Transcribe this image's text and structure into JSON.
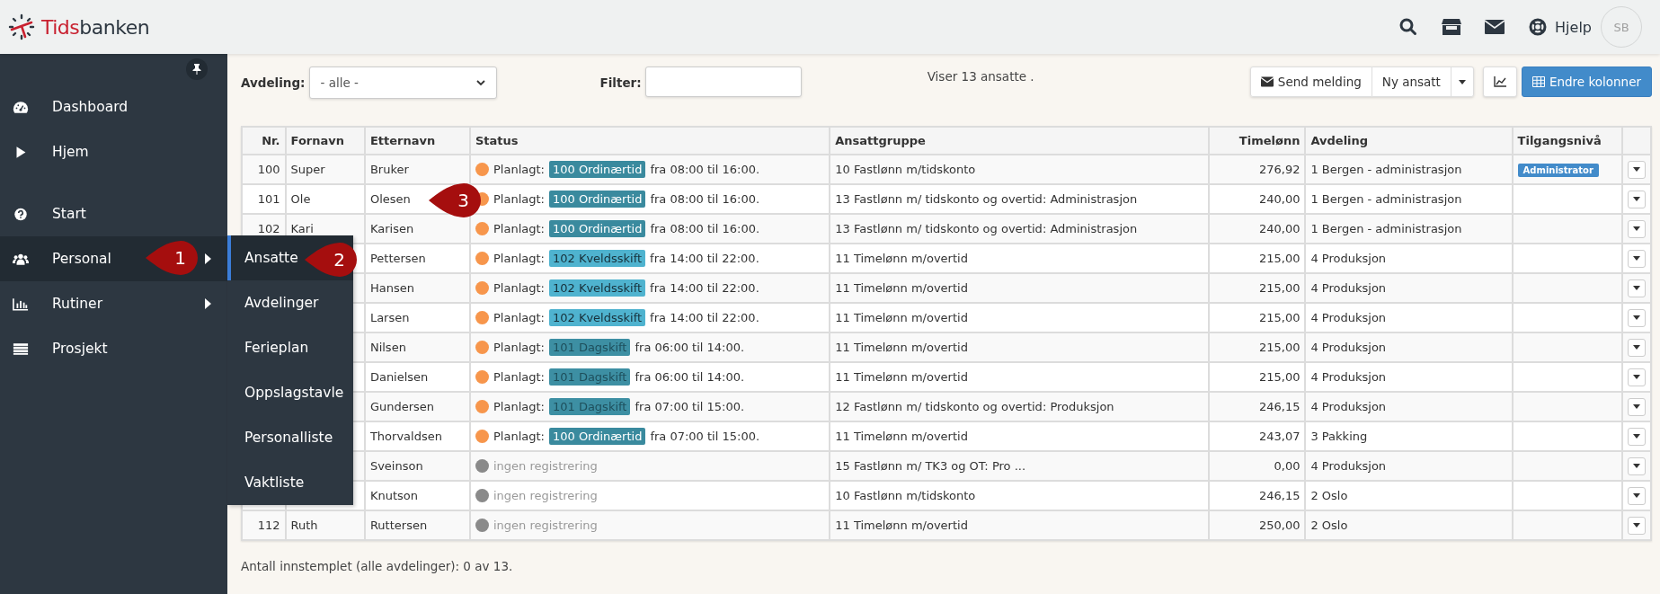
{
  "header": {
    "logo_accent": "Tids",
    "logo_rest": "banken",
    "help": "Hjelp",
    "avatar": "SB"
  },
  "sidebar": {
    "groups": [
      [
        {
          "label": "Dashboard",
          "selected": false,
          "has_submenu": false
        },
        {
          "label": "Hjem",
          "selected": false,
          "has_submenu": false
        }
      ],
      [
        {
          "label": "Start",
          "selected": false,
          "has_submenu": false
        },
        {
          "label": "Personal",
          "selected": true,
          "has_submenu": true
        },
        {
          "label": "Rutiner",
          "selected": false,
          "has_submenu": true
        },
        {
          "label": "Prosjekt",
          "selected": false,
          "has_submenu": false
        }
      ]
    ]
  },
  "submenu": {
    "items": [
      {
        "label": "Ansatte",
        "selected": true
      },
      {
        "label": "Avdelinger",
        "selected": false
      },
      {
        "label": "Ferieplan",
        "selected": false
      },
      {
        "label": "Oppslagstavle",
        "selected": false
      },
      {
        "label": "Personalliste",
        "selected": false
      },
      {
        "label": "Vaktliste",
        "selected": false
      }
    ]
  },
  "toolbar": {
    "department_label": "Avdeling:",
    "department_value": "- alle -",
    "filter_label": "Filter:",
    "summary": "Viser 13 ansatte .",
    "buttons": [
      "Send melding",
      "Ny ansatt"
    ],
    "columns_button": "Endre kolonner"
  },
  "table": {
    "columns": [
      "Nr.",
      "Fornavn",
      "Etternavn",
      "Status",
      "Ansattgruppe",
      "Timelønn",
      "Avdeling",
      "Tilgangsnivå"
    ],
    "rows": [
      {
        "nr": "100",
        "first": "Super",
        "last": "Bruker",
        "status": {
          "kind": "planned",
          "label": "Planlagt:",
          "shift": "100 Ordinærtid",
          "color": "#3a8a9e",
          "time": "fra 08:00 til 16:00."
        },
        "group": "10 Fastlønn m/tidskonto",
        "wage": "276,92",
        "department": "1 Bergen - administrasjon",
        "access": "Administrator"
      },
      {
        "nr": "101",
        "first": "Ole",
        "last": "Olesen",
        "status": {
          "kind": "planned",
          "label": "Planlagt:",
          "shift": "100 Ordinærtid",
          "color": "#3a8a9e",
          "time": "fra 08:00 til 16:00."
        },
        "group": "13 Fastlønn m/ tidskonto og overtid: Administrasjon",
        "wage": "240,00",
        "department": "1 Bergen - administrasjon"
      },
      {
        "nr": "102",
        "first": "Kari",
        "last": "Karisen",
        "status": {
          "kind": "planned",
          "label": "Planlagt:",
          "shift": "100 Ordinærtid",
          "color": "#3a8a9e",
          "time": "fra 08:00 til 16:00."
        },
        "group": "13 Fastlønn m/ tidskonto og overtid: Administrasjon",
        "wage": "240,00",
        "department": "1 Bergen - administrasjon"
      },
      {
        "last": "Pettersen",
        "status": {
          "kind": "planned",
          "label": "Planlagt:",
          "shift": "102 Kveldsskift",
          "color": "#4fb3cf",
          "time": "fra 14:00 til 22:00."
        },
        "group": "11 Timelønn m/overtid",
        "wage": "215,00",
        "department": "4 Produksjon"
      },
      {
        "last": "Hansen",
        "status": {
          "kind": "planned",
          "label": "Planlagt:",
          "shift": "102 Kveldsskift",
          "color": "#4fb3cf",
          "time": "fra 14:00 til 22:00."
        },
        "group": "11 Timelønn m/overtid",
        "wage": "215,00",
        "department": "4 Produksjon"
      },
      {
        "last": "Larsen",
        "status": {
          "kind": "planned",
          "label": "Planlagt:",
          "shift": "102 Kveldsskift",
          "color": "#4fb3cf",
          "time": "fra 14:00 til 22:00."
        },
        "group": "11 Timelønn m/overtid",
        "wage": "215,00",
        "department": "4 Produksjon"
      },
      {
        "last": "Nilsen",
        "status": {
          "kind": "planned",
          "label": "Planlagt:",
          "shift": "101 Dagskift",
          "color": "#3d8fa3",
          "time": "fra 06:00 til 14:00."
        },
        "group": "11 Timelønn m/overtid",
        "wage": "215,00",
        "department": "4 Produksjon"
      },
      {
        "last": "Danielsen",
        "status": {
          "kind": "planned",
          "label": "Planlagt:",
          "shift": "101 Dagskift",
          "color": "#3d8fa3",
          "time": "fra 06:00 til 14:00."
        },
        "group": "11 Timelønn m/overtid",
        "wage": "215,00",
        "department": "4 Produksjon"
      },
      {
        "last": "Gundersen",
        "status": {
          "kind": "planned",
          "label": "Planlagt:",
          "shift": "101 Dagskift",
          "color": "#3d8fa3",
          "time": "fra 07:00 til 15:00."
        },
        "group": "12 Fastlønn m/ tidskonto og overtid: Produksjon",
        "wage": "246,15",
        "department": "4 Produksjon"
      },
      {
        "last": "Thorvaldsen",
        "status": {
          "kind": "planned",
          "label": "Planlagt:",
          "shift": "100 Ordinærtid",
          "color": "#3a8a9e",
          "time": "fra 07:00 til 15:00."
        },
        "group": "11 Timelønn m/overtid",
        "wage": "243,07",
        "department": "3 Pakking"
      },
      {
        "last": "Sveinson",
        "status": {
          "kind": "none",
          "label": "ingen registrering"
        },
        "group": "15 Fastlønn m/ TK3 og OT: Pro ...",
        "wage": "0,00",
        "department": "4 Produksjon"
      },
      {
        "last": "Knutson",
        "status": {
          "kind": "none",
          "label": "ingen registrering"
        },
        "group": "10 Fastlønn m/tidskonto",
        "wage": "246,15",
        "department": "2 Oslo"
      },
      {
        "nr": "112",
        "first": "Ruth",
        "last": "Ruttersen",
        "status": {
          "kind": "none",
          "label": "ingen registrering"
        },
        "group": "11 Timelønn m/overtid",
        "wage": "250,00",
        "department": "2 Oslo"
      }
    ]
  },
  "footer": "Antall innstemplet (alle avdelinger): 0 av 13.",
  "callouts": [
    "1",
    "2",
    "3"
  ]
}
